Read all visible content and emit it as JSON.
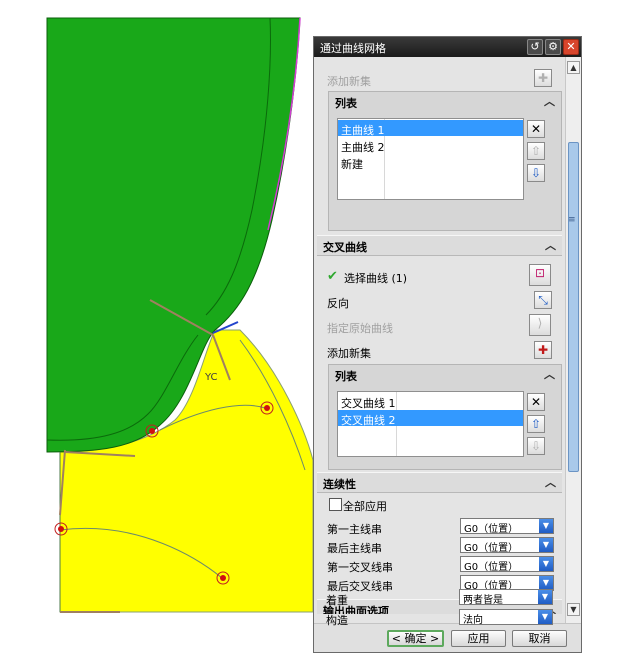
{
  "viewport": {
    "axis_label": "YC"
  },
  "dialog": {
    "title": "通过曲线网格",
    "top_partial": {
      "add_new_label": "添加新集",
      "list_title": "列表",
      "items": [
        {
          "label": "主曲线 1",
          "selected": true
        },
        {
          "label": "主曲线 2",
          "selected": false
        },
        {
          "label": "新建",
          "selected": false
        }
      ]
    },
    "cross_curves": {
      "title": "交叉曲线",
      "select_curve_label": "选择曲线 (1)",
      "reverse_label": "反向",
      "specify_origin_label": "指定原始曲线",
      "add_new_label": "添加新集",
      "list_title": "列表",
      "items": [
        {
          "label": "交叉曲线 1",
          "selected": false
        },
        {
          "label": "交叉曲线 2",
          "selected": true
        }
      ]
    },
    "continuity": {
      "title": "连续性",
      "apply_all_label": "全部应用",
      "rows": [
        {
          "label": "第一主线串",
          "value": "G0（位置）"
        },
        {
          "label": "最后主线串",
          "value": "G0（位置）"
        },
        {
          "label": "第一交叉线串",
          "value": "G0（位置）"
        },
        {
          "label": "最后交叉线串",
          "value": "G0（位置）"
        }
      ]
    },
    "output_options": {
      "title": "输出曲面选项",
      "emphasis_label": "着重",
      "emphasis_value": "两者皆是",
      "construct_label": "构造",
      "construct_value": "法向"
    },
    "buttons": {
      "ok": "< 确定 >",
      "apply": "应用",
      "cancel": "取消"
    },
    "colors": {
      "selection": "#3399ff",
      "accent_ok": "#5da95d",
      "check": "#2fa82f"
    }
  }
}
